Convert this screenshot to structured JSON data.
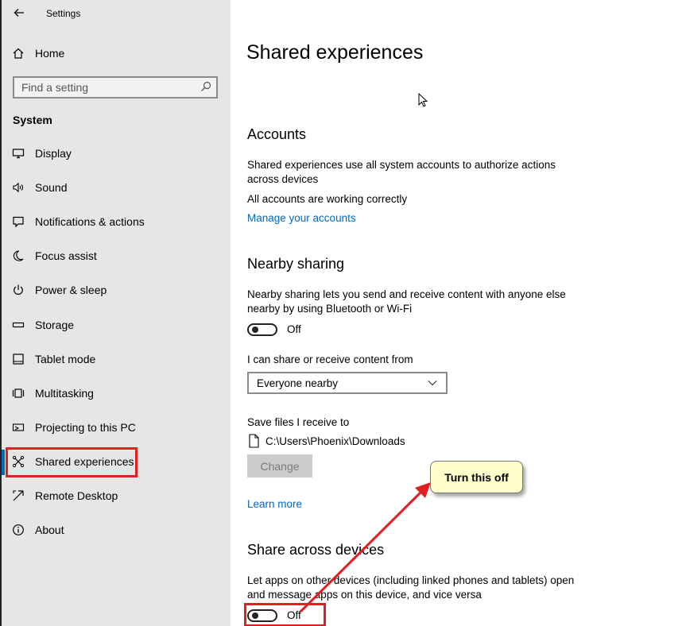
{
  "window": {
    "title": "Settings"
  },
  "sidebar": {
    "home_label": "Home",
    "search_placeholder": "Find a setting",
    "section_label": "System",
    "items": [
      {
        "label": "Display",
        "icon": "monitor-icon"
      },
      {
        "label": "Sound",
        "icon": "speaker-icon"
      },
      {
        "label": "Notifications & actions",
        "icon": "notification-icon"
      },
      {
        "label": "Focus assist",
        "icon": "moon-icon"
      },
      {
        "label": "Power & sleep",
        "icon": "power-icon"
      },
      {
        "label": "Storage",
        "icon": "storage-icon"
      },
      {
        "label": "Tablet mode",
        "icon": "tablet-icon"
      },
      {
        "label": "Multitasking",
        "icon": "multitasking-icon"
      },
      {
        "label": "Projecting to this PC",
        "icon": "projector-icon"
      },
      {
        "label": "Shared experiences",
        "icon": "shared-experiences-icon",
        "selected": true
      },
      {
        "label": "Remote Desktop",
        "icon": "remote-desktop-icon"
      },
      {
        "label": "About",
        "icon": "info-icon"
      }
    ]
  },
  "main": {
    "page_title": "Shared experiences",
    "accounts": {
      "heading": "Accounts",
      "description": "Shared experiences use all system accounts to authorize actions across devices",
      "status": "All accounts are working correctly",
      "link": "Manage your accounts"
    },
    "nearby_sharing": {
      "heading": "Nearby sharing",
      "description": "Nearby sharing lets you send and receive content with anyone else nearby by using Bluetooth or Wi-Fi",
      "toggle_state": "Off",
      "share_from_label": "I can share or receive content from",
      "share_from_value": "Everyone nearby",
      "save_files_label": "Save files I receive to",
      "save_path": "C:\\Users\\Phoenix\\Downloads",
      "change_button": "Change",
      "learn_more": "Learn more"
    },
    "share_across_devices": {
      "heading": "Share across devices",
      "description": "Let apps on other devices (including linked phones and tablets) open and message apps on this device, and vice versa",
      "toggle_state": "Off"
    }
  },
  "annotation": {
    "callout_text": "Turn this off",
    "highlight_color": "#e02020",
    "callout_color": "#ffffcc"
  },
  "colors": {
    "accent": "#0067c0",
    "sidebar_bg": "#e6e6e6"
  }
}
